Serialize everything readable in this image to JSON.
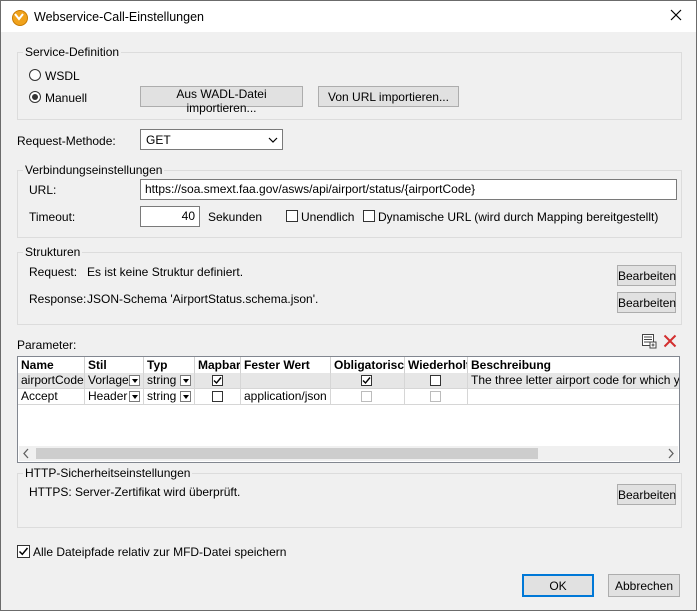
{
  "window": {
    "title": "Webservice-Call-Einstellungen"
  },
  "service_definition": {
    "label": "Service-Definition",
    "options": [
      "WSDL",
      "Manuell"
    ],
    "selected": "Manuell",
    "import_wadl_button": "Aus WADL-Datei importieren...",
    "import_url_button": "Von URL importieren..."
  },
  "request_method": {
    "label": "Request-Methode:",
    "value": "GET"
  },
  "connection": {
    "label": "Verbindungseinstellungen",
    "url_label": "URL:",
    "url_value": "https://soa.smext.faa.gov/asws/api/airport/status/{airportCode}",
    "timeout_label": "Timeout:",
    "timeout_value": "40",
    "seconds_label": "Sekunden",
    "infinite_label": "Unendlich",
    "dynamic_url_label": "Dynamische URL (wird durch Mapping bereitgestellt)"
  },
  "structures": {
    "label": "Strukturen",
    "request_label": "Request:",
    "request_value": "Es ist keine Struktur definiert.",
    "response_label": "Response:",
    "response_value": "JSON-Schema 'AirportStatus.schema.json'.",
    "edit_button": "Bearbeiten"
  },
  "parameters": {
    "label": "Parameter:",
    "columns": [
      "Name",
      "Stil",
      "Typ",
      "Mapbar",
      "Fester Wert",
      "Obligatorisch",
      "Wiederholt",
      "Beschreibung"
    ],
    "rows": [
      {
        "name": "airportCode",
        "style": "Vorlage",
        "type": "string",
        "mappable": true,
        "fixed_value": "",
        "mandatory": true,
        "repeated": false,
        "description": "The three letter airport code for which you"
      },
      {
        "name": "Accept",
        "style": "Header",
        "type": "string",
        "mappable": false,
        "fixed_value": "application/json",
        "mandatory": false,
        "repeated": false,
        "description": ""
      }
    ],
    "icons": [
      "add-parameter-icon",
      "delete-icon"
    ]
  },
  "http_security": {
    "label": "HTTP-Sicherheitseinstellungen",
    "value": "HTTPS: Server-Zertifikat wird überprüft.",
    "edit_button": "Bearbeiten"
  },
  "relative_paths": {
    "label": "Alle Dateipfade relativ zur MFD-Datei speichern",
    "checked": true
  },
  "footer": {
    "ok": "OK",
    "cancel": "Abbrechen"
  },
  "colors": {
    "accent": "#0078d7",
    "delete_red": "#d32f2f",
    "selected_row": "#e6e6e6"
  }
}
